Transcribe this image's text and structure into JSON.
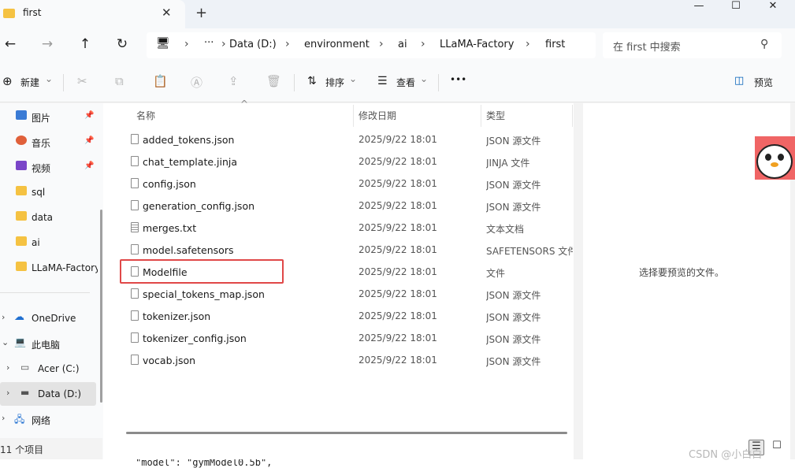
{
  "tab": {
    "title": "first",
    "close": "✕",
    "new": "+"
  },
  "window": {
    "minimize": "—",
    "maximize": "☐",
    "close": "✕"
  },
  "nav": {
    "back": "←",
    "forward": "→",
    "up": "↑",
    "refresh": "↻",
    "pc_icon": "🖥",
    "chevron": "›",
    "more": "···"
  },
  "breadcrumb": [
    "Data (D:)",
    "environment",
    "ai",
    "LLaMA-Factory",
    "first"
  ],
  "search": {
    "placeholder": "在 first 中搜索",
    "icon": "⚲"
  },
  "toolbar": {
    "new_label": "新建",
    "new_icon": "⊕",
    "cut": "✂",
    "copy": "⧉",
    "paste": "📋",
    "rename": "Ⓐ",
    "share": "⇪",
    "delete": "🗑",
    "sort_label": "排序",
    "sort_icon": "⇅",
    "view_label": "查看",
    "view_icon": "☰",
    "more": "•••",
    "preview_label": "预览",
    "preview_icon": "◫",
    "dropdown": "⌄"
  },
  "sidebar": {
    "pinned": [
      {
        "label": "图片",
        "color": "#3a7bd5"
      },
      {
        "label": "音乐",
        "color": "#e0603a"
      },
      {
        "label": "视频",
        "color": "#7a45c8"
      },
      {
        "label": "sql"
      },
      {
        "label": "data"
      },
      {
        "label": "ai"
      },
      {
        "label": "LLaMA-Factory"
      }
    ],
    "pin": "📌",
    "drives": [
      {
        "label": "OneDrive",
        "chev": "›",
        "icon": "☁"
      },
      {
        "label": "此电脑",
        "chev": "⌄",
        "icon": "💻"
      },
      {
        "label": "Acer (C:)",
        "chev": "›",
        "icon": "▭"
      },
      {
        "label": "Data (D:)",
        "chev": "›",
        "icon": "▬"
      },
      {
        "label": "网络",
        "chev": "›",
        "icon": "🖧"
      }
    ]
  },
  "columns": {
    "name": "名称",
    "date": "修改日期",
    "type": "类型",
    "sort_arrow": "^"
  },
  "files": [
    {
      "name": "added_tokens.json",
      "date": "2025/9/22 18:01",
      "type": "JSON 源文件"
    },
    {
      "name": "chat_template.jinja",
      "date": "2025/9/22 18:01",
      "type": "JINJA 文件"
    },
    {
      "name": "config.json",
      "date": "2025/9/22 18:01",
      "type": "JSON 源文件"
    },
    {
      "name": "generation_config.json",
      "date": "2025/9/22 18:01",
      "type": "JSON 源文件"
    },
    {
      "name": "merges.txt",
      "date": "2025/9/22 18:01",
      "type": "文本文档"
    },
    {
      "name": "model.safetensors",
      "date": "2025/9/22 18:01",
      "type": "SAFETENSORS 文件"
    },
    {
      "name": "Modelfile",
      "date": "2025/9/22 18:01",
      "type": "文件"
    },
    {
      "name": "special_tokens_map.json",
      "date": "2025/9/22 18:01",
      "type": "JSON 源文件"
    },
    {
      "name": "tokenizer.json",
      "date": "2025/9/22 18:01",
      "type": "JSON 源文件"
    },
    {
      "name": "tokenizer_config.json",
      "date": "2025/9/22 18:01",
      "type": "JSON 源文件"
    },
    {
      "name": "vocab.json",
      "date": "2025/9/22 18:01",
      "type": "JSON 源文件"
    }
  ],
  "preview_pane": {
    "message": "选择要预览的文件。"
  },
  "status": {
    "count": "11 个项目",
    "details_view": "☰",
    "tiles_view": "☐"
  },
  "background": {
    "code_line": "\"model\": \"gymModel0.5b\","
  },
  "watermark": "CSDN @小白白",
  "colors": {
    "folder": "#f5c242",
    "highlight": "#e04848",
    "accent": "#005fb8"
  }
}
